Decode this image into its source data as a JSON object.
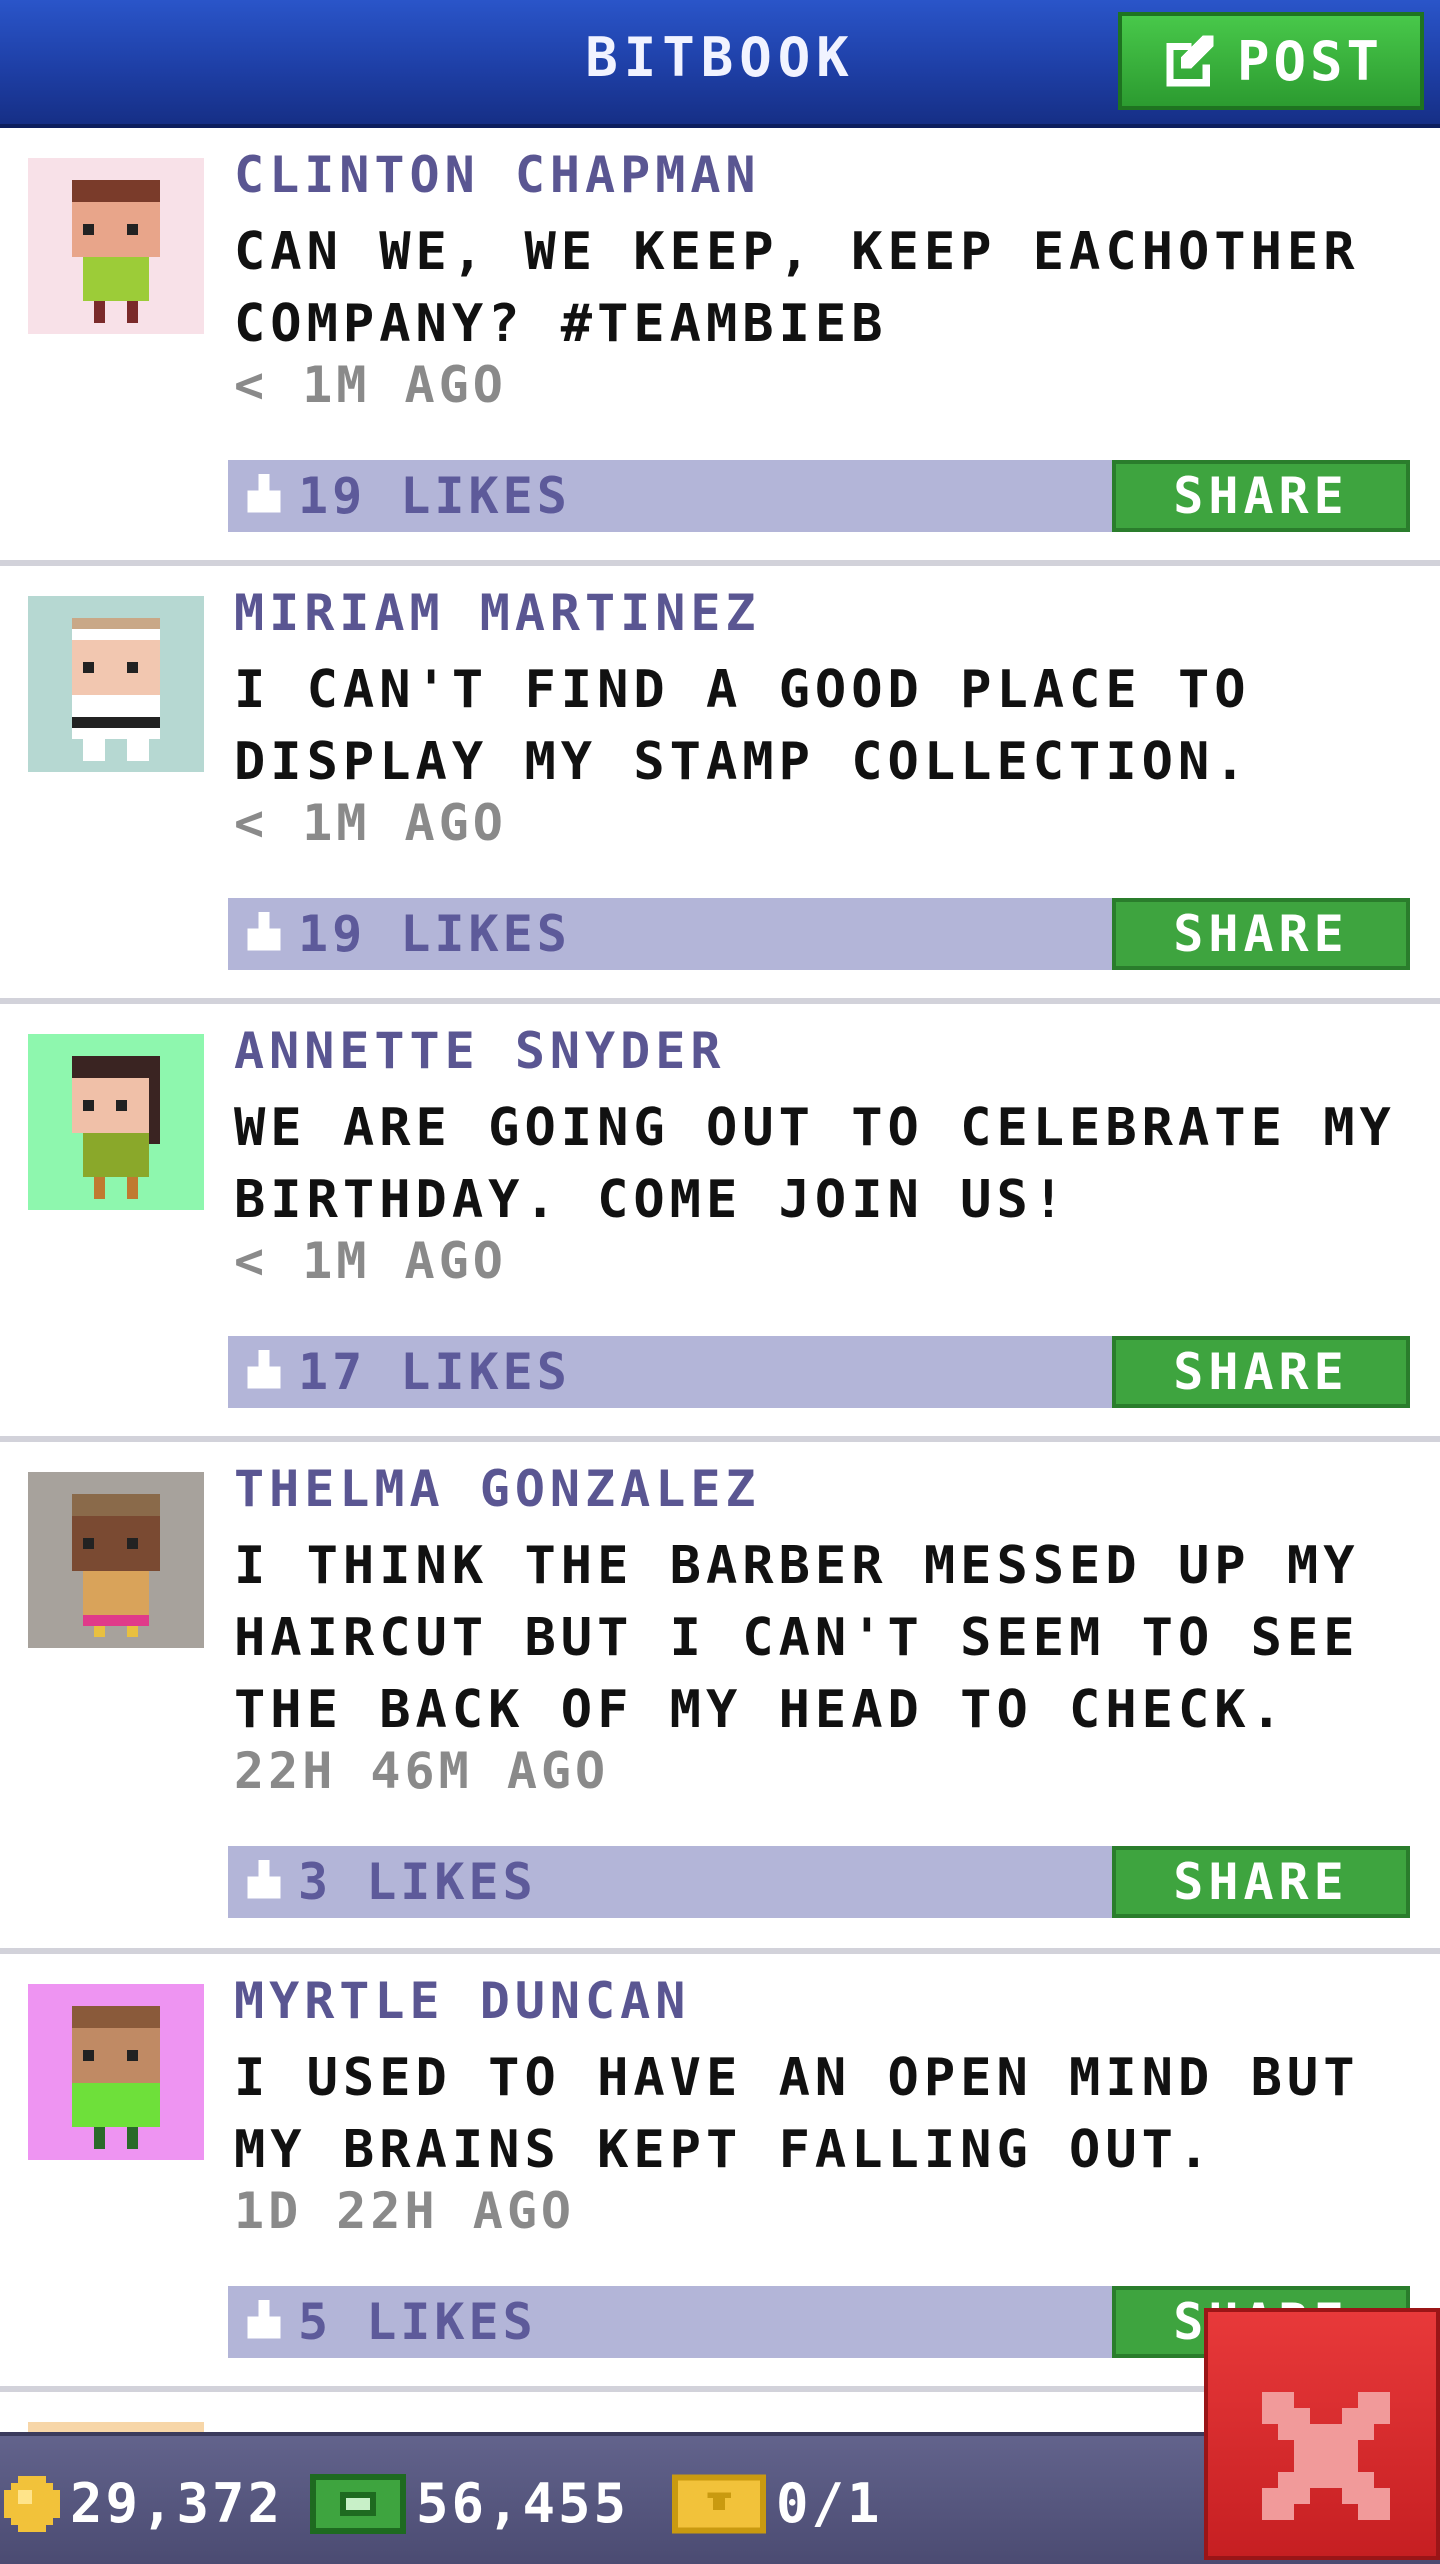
{
  "header": {
    "title": "BITBOOK",
    "post_label": "POST"
  },
  "posts": [
    {
      "author": "CLINTON CHAPMAN",
      "message": "CAN WE, WE KEEP, KEEP EACHOTHER COMPANY? #TEAMBIEB",
      "time": "< 1M AGO",
      "likes": "19 LIKES",
      "share": "SHARE",
      "avatar_bg": "#f8e1e8"
    },
    {
      "author": "MIRIAM MARTINEZ",
      "message": "I CAN'T FIND A GOOD PLACE TO DISPLAY MY STAMP COLLECTION.",
      "time": "< 1M AGO",
      "likes": "19 LIKES",
      "share": "SHARE",
      "avatar_bg": "#b6d8d2"
    },
    {
      "author": "ANNETTE SNYDER",
      "message": "WE ARE GOING OUT TO CELEBRATE MY BIRTHDAY. COME JOIN US!",
      "time": "< 1M AGO",
      "likes": "17 LIKES",
      "share": "SHARE",
      "avatar_bg": "#8ef7ae"
    },
    {
      "author": "THELMA GONZALEZ",
      "message": "I THINK THE BARBER MESSED UP MY HAIRCUT BUT I CAN'T SEEM TO SEE THE BACK OF MY HEAD TO CHECK.",
      "time": "22H 46M AGO",
      "likes": "3 LIKES",
      "share": "SHARE",
      "avatar_bg": "#a7a29c"
    },
    {
      "author": "MYRTLE DUNCAN",
      "message": "I USED TO HAVE AN OPEN MIND BUT MY BRAINS KEPT FALLING OUT.",
      "time": "1D 22H AGO",
      "likes": "5 LIKES",
      "share": "SHARE",
      "avatar_bg": "#ee94f2"
    }
  ],
  "status": {
    "coins": "29,372",
    "bux": "56,455",
    "tickets": "0/1"
  },
  "colors": {
    "header": "#1e3fa6",
    "accent_green": "#3ea43f",
    "like_bar": "#b3b5d8",
    "close": "#d42a2c"
  }
}
